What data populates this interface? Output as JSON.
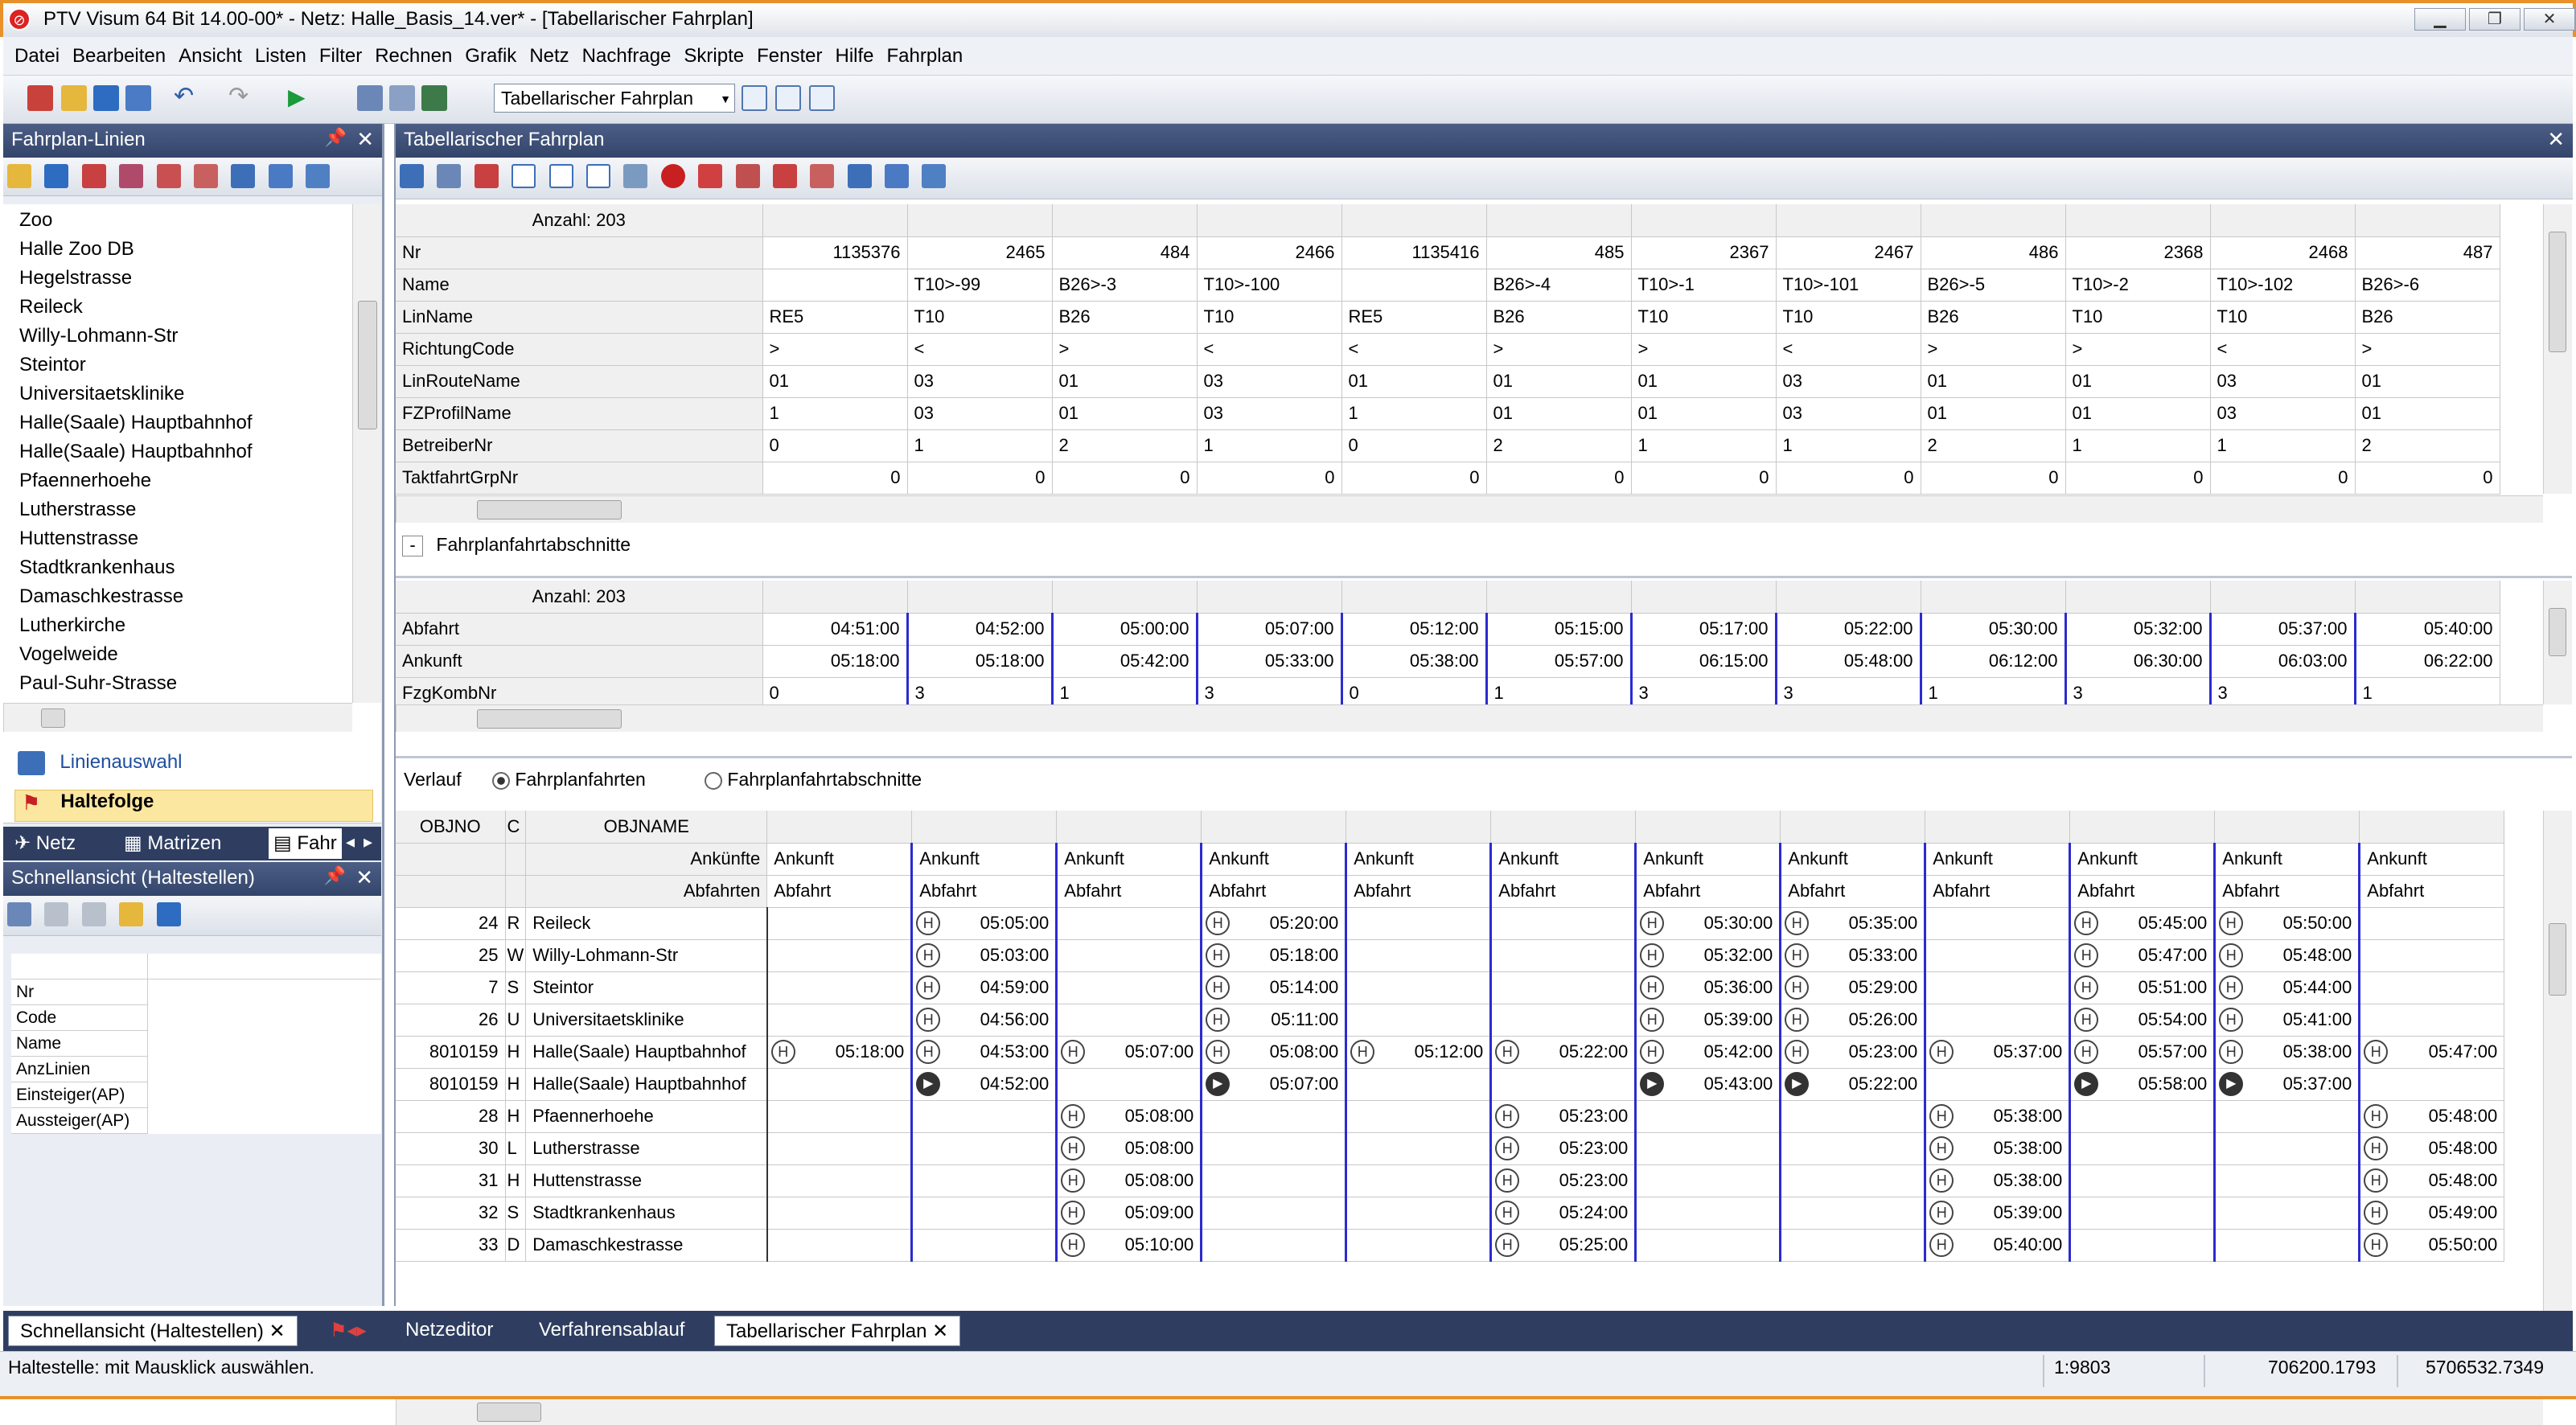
{
  "window": {
    "title": "PTV Visum 64 Bit 14.00-00* - Netz: Halle_Basis_14.ver* - [Tabellarischer Fahrplan]"
  },
  "menu": [
    "Datei",
    "Bearbeiten",
    "Ansicht",
    "Listen",
    "Filter",
    "Rechnen",
    "Grafik",
    "Netz",
    "Nachfrage",
    "Skripte",
    "Fenster",
    "Hilfe",
    "Fahrplan"
  ],
  "toolbar": {
    "view_select": "Tabellarischer Fahrplan"
  },
  "left_panel": {
    "title": "Fahrplan-Linien",
    "stops": [
      "Zoo",
      "Halle Zoo DB",
      "Hegelstrasse",
      "Reileck",
      "Willy-Lohmann-Str",
      "Steintor",
      "Universitaetsklinike",
      "Halle(Saale) Hauptbahnhof",
      "Halle(Saale) Hauptbahnhof",
      "Pfaennerhoehe",
      "Lutherstrasse",
      "Huttenstrasse",
      "Stadtkrankenhaus",
      "Damaschkestrasse",
      "Lutherkirche",
      "Vogelweide",
      "Paul-Suhr-Strasse"
    ],
    "links": [
      {
        "label": "Linienauswahl"
      },
      {
        "label": "Haltefolge"
      }
    ],
    "tabs": [
      "Netz",
      "Matrizen",
      "Fahr"
    ]
  },
  "quick_panel": {
    "title": "Schnellansicht (Haltestellen)",
    "fields": [
      "Nr",
      "Code",
      "Name",
      "AnzLinien",
      "Einsteiger(AP)",
      "Aussteiger(AP)"
    ]
  },
  "main": {
    "title": "Tabellarischer Fahrplan",
    "top": {
      "count": "Anzahl: 203",
      "rows": [
        {
          "label": "Nr",
          "values": [
            "1135376",
            "2465",
            "484",
            "2466",
            "1135416",
            "485",
            "2367",
            "2467",
            "486",
            "2368",
            "2468",
            "487"
          ],
          "align": "right"
        },
        {
          "label": "Name",
          "values": [
            "",
            "T10>-99",
            "B26>-3",
            "T10>-100",
            "",
            "B26>-4",
            "T10>-1",
            "T10>-101",
            "B26>-5",
            "T10>-2",
            "T10>-102",
            "B26>-6"
          ],
          "align": "left"
        },
        {
          "label": "LinName",
          "values": [
            "RE5",
            "T10",
            "B26",
            "T10",
            "RE5",
            "B26",
            "T10",
            "T10",
            "B26",
            "T10",
            "T10",
            "B26"
          ],
          "align": "left"
        },
        {
          "label": "RichtungCode",
          "values": [
            ">",
            "<",
            ">",
            "<",
            "<",
            ">",
            ">",
            "<",
            ">",
            ">",
            "<",
            ">"
          ],
          "align": "left"
        },
        {
          "label": "LinRouteName",
          "values": [
            "01",
            "03",
            "01",
            "03",
            "01",
            "01",
            "01",
            "03",
            "01",
            "01",
            "03",
            "01"
          ],
          "align": "left"
        },
        {
          "label": "FZProfilName",
          "values": [
            "1",
            "03",
            "01",
            "03",
            "1",
            "01",
            "01",
            "03",
            "01",
            "01",
            "03",
            "01"
          ],
          "align": "left"
        },
        {
          "label": "BetreiberNr",
          "values": [
            "0",
            "1",
            "2",
            "1",
            "0",
            "2",
            "1",
            "1",
            "2",
            "1",
            "1",
            "2"
          ],
          "align": "left"
        },
        {
          "label": "TaktfahrtGrpNr",
          "values": [
            "0",
            "0",
            "0",
            "0",
            "0",
            "0",
            "0",
            "0",
            "0",
            "0",
            "0",
            "0"
          ],
          "align": "right"
        }
      ]
    },
    "section_label": "Fahrplanfahrtabschnitte",
    "middle": {
      "count": "Anzahl: 203",
      "rows": [
        {
          "label": "Abfahrt",
          "values": [
            "04:51:00",
            "04:52:00",
            "05:00:00",
            "05:07:00",
            "05:12:00",
            "05:15:00",
            "05:17:00",
            "05:22:00",
            "05:30:00",
            "05:32:00",
            "05:37:00",
            "05:40:00"
          ],
          "align": "right"
        },
        {
          "label": "Ankunft",
          "values": [
            "05:18:00",
            "05:18:00",
            "05:42:00",
            "05:33:00",
            "05:38:00",
            "05:57:00",
            "06:15:00",
            "05:48:00",
            "06:12:00",
            "06:30:00",
            "06:03:00",
            "06:22:00"
          ],
          "align": "right"
        },
        {
          "label": "FzgKombNr",
          "values": [
            "0",
            "3",
            "1",
            "3",
            "0",
            "1",
            "3",
            "3",
            "1",
            "3",
            "3",
            "1"
          ],
          "align": "left"
        }
      ]
    },
    "verlauf": {
      "label": "Verlauf",
      "option1": "Fahrplanfahrten",
      "option2": "Fahrplanfahrtabschnitte"
    },
    "bottom": {
      "col_objno": "OBJNO",
      "col_c": "C",
      "col_objname": "OBJNAME",
      "ank_label": "Ankünfte",
      "abf_label": "Abfahrten",
      "ank": "Ankunft",
      "abf": "Abfahrt",
      "rows": [
        {
          "no": "24",
          "c": "R",
          "name": "Reileck",
          "t": [
            "",
            "05:05:00",
            "",
            "05:20:00",
            "",
            "",
            "05:30:00",
            "05:35:00",
            "",
            "05:45:00",
            "05:50:00",
            ""
          ]
        },
        {
          "no": "25",
          "c": "W",
          "name": "Willy-Lohmann-Str",
          "t": [
            "",
            "05:03:00",
            "",
            "05:18:00",
            "",
            "",
            "05:32:00",
            "05:33:00",
            "",
            "05:47:00",
            "05:48:00",
            ""
          ]
        },
        {
          "no": "7",
          "c": "S",
          "name": "Steintor",
          "t": [
            "",
            "04:59:00",
            "",
            "05:14:00",
            "",
            "",
            "05:36:00",
            "05:29:00",
            "",
            "05:51:00",
            "05:44:00",
            ""
          ]
        },
        {
          "no": "26",
          "c": "U",
          "name": "Universitaetsklinike",
          "t": [
            "",
            "04:56:00",
            "",
            "05:11:00",
            "",
            "",
            "05:39:00",
            "05:26:00",
            "",
            "05:54:00",
            "05:41:00",
            ""
          ]
        },
        {
          "no": "8010159",
          "c": "H",
          "name": "Halle(Saale) Hauptbahnhof",
          "t": [
            "05:18:00",
            "04:53:00",
            "05:07:00",
            "05:08:00",
            "05:12:00",
            "05:22:00",
            "05:42:00",
            "05:23:00",
            "05:37:00",
            "05:57:00",
            "05:38:00",
            "05:47:00"
          ]
        },
        {
          "no": "8010159",
          "c": "H",
          "name": "Halle(Saale) Hauptbahnhof",
          "t": [
            "",
            "04:52:00",
            "",
            "05:07:00",
            "",
            "",
            "05:43:00",
            "05:22:00",
            "",
            "05:58:00",
            "05:37:00",
            ""
          ]
        },
        {
          "no": "28",
          "c": "H",
          "name": "Pfaennerhoehe",
          "t": [
            "",
            "",
            "05:08:00",
            "",
            "",
            "05:23:00",
            "",
            "",
            "05:38:00",
            "",
            "",
            "05:48:00"
          ]
        },
        {
          "no": "30",
          "c": "L",
          "name": "Lutherstrasse",
          "t": [
            "",
            "",
            "05:08:00",
            "",
            "",
            "05:23:00",
            "",
            "",
            "05:38:00",
            "",
            "",
            "05:48:00"
          ]
        },
        {
          "no": "31",
          "c": "H",
          "name": "Huttenstrasse",
          "t": [
            "",
            "",
            "05:08:00",
            "",
            "",
            "05:23:00",
            "",
            "",
            "05:38:00",
            "",
            "",
            "05:48:00"
          ]
        },
        {
          "no": "32",
          "c": "S",
          "name": "Stadtkrankenhaus",
          "t": [
            "",
            "",
            "05:09:00",
            "",
            "",
            "05:24:00",
            "",
            "",
            "05:39:00",
            "",
            "",
            "05:49:00"
          ]
        },
        {
          "no": "33",
          "c": "D",
          "name": "Damaschkestrasse",
          "t": [
            "",
            "",
            "05:10:00",
            "",
            "",
            "05:25:00",
            "",
            "",
            "05:40:00",
            "",
            "",
            "05:50:00"
          ]
        }
      ]
    }
  },
  "bottom_tabs": [
    "Schnellansicht (Haltestellen)",
    "Netzeditor",
    "Verfahrensablauf",
    "Tabellarischer Fahrplan"
  ],
  "status": {
    "text": "Haltestelle: mit Mausklick auswählen.",
    "scale": "1:9803",
    "x": "706200.1793",
    "y": "5706532.7349"
  },
  "colors": {
    "title_border": "#e8912a",
    "panel_title": "#3d4f77",
    "trip_separator": "#2b2bd0"
  }
}
